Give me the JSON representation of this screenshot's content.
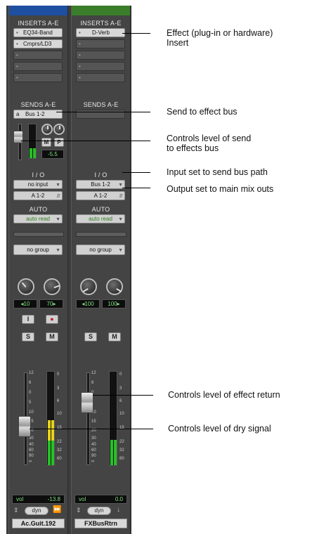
{
  "strips": [
    {
      "color": "#1e4fa0",
      "inserts_label": "INSERTS A-E",
      "inserts": [
        "EQ34-Band",
        "Cmprs/LD3",
        "",
        "",
        ""
      ],
      "sends_label": "SENDS A-E",
      "send_letter": "a",
      "send_name": "Bus 1-2",
      "send_level": "-5.5",
      "send_mute": "M",
      "send_pre": "P",
      "io_label": "I / O",
      "input": "no input",
      "output": "A 1-2",
      "auto_label": "AUTO",
      "auto_mode": "auto read",
      "group": "no group",
      "pan_left": "10",
      "pan_right": "70",
      "input_button": "I",
      "solo": "S",
      "mute": "M",
      "fader_scale": [
        "12",
        "6",
        "0",
        "5",
        "10",
        "15",
        "20",
        "30",
        "40",
        "60",
        "90",
        "∞"
      ],
      "meter_scale": [
        "0",
        "3",
        "6",
        "10",
        "15",
        "22",
        "32",
        "60"
      ],
      "vol_label": "vol",
      "vol_value": "-13.8",
      "dyn_label": "dyn",
      "name": "Ac.Guit.192",
      "meter_level": 0.48,
      "fader_position": 0.62
    },
    {
      "color": "#3a7d2a",
      "inserts_label": "INSERTS A-E",
      "inserts": [
        "D-Verb",
        "",
        "",
        "",
        ""
      ],
      "sends_label": "SENDS A-E",
      "io_label": "I / O",
      "input": "Bus 1-2",
      "output": "A 1-2",
      "auto_label": "AUTO",
      "auto_mode": "auto read",
      "group": "no group",
      "pan_left": "100",
      "pan_right": "100",
      "solo": "S",
      "mute": "M",
      "fader_scale": [
        "12",
        "6",
        "0",
        "5",
        "10",
        "15",
        "20",
        "30",
        "40",
        "60",
        "90",
        "∞"
      ],
      "meter_scale": [
        "0",
        "3",
        "6",
        "10",
        "15",
        "22",
        "32",
        "60"
      ],
      "vol_label": "vol",
      "vol_value": "0.0",
      "dyn_label": "dyn",
      "name": "FXBusRtrn",
      "meter_level": 0.27,
      "fader_position": 0.28
    }
  ],
  "callouts": [
    "Effect (plug-in or hardware)\nInsert",
    "Send to effect bus",
    "Controls level of send\nto effects bus",
    "Input set to send bus path",
    "Output set to main mix outs",
    "Controls level of effect return",
    "Controls level of dry signal"
  ]
}
